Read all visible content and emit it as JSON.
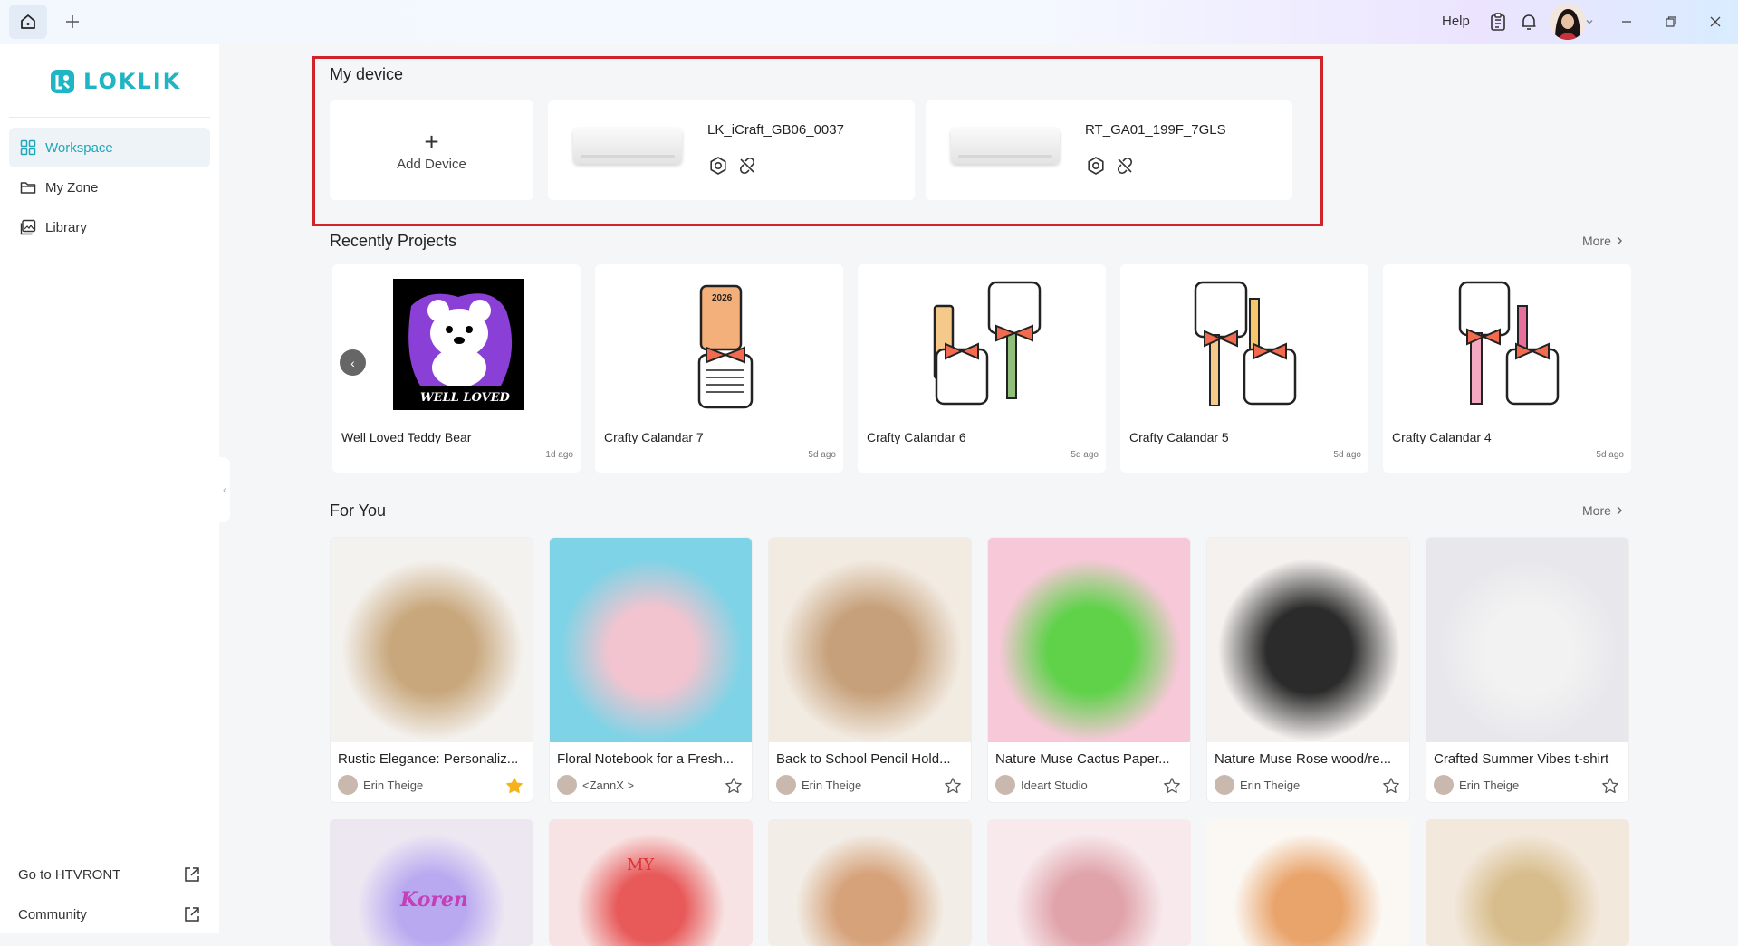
{
  "titlebar": {
    "help_label": "Help",
    "icons": [
      "home-icon",
      "plus-icon",
      "clipboard-icon",
      "bell-icon",
      "chevron-down-icon",
      "minimize-icon",
      "restore-icon",
      "close-icon"
    ]
  },
  "sidebar": {
    "logo_text": "LOKLIK",
    "items": [
      {
        "label": "Workspace",
        "icon": "grid-icon",
        "active": true
      },
      {
        "label": "My Zone",
        "icon": "folder-icon",
        "active": false
      },
      {
        "label": "Library",
        "icon": "image-icon",
        "active": false
      }
    ],
    "bottom": [
      {
        "label": "Go to HTVRONT",
        "icon": "external-link-icon"
      },
      {
        "label": "Community",
        "icon": "external-link-icon"
      }
    ]
  },
  "devices": {
    "title": "My device",
    "add_label": "Add Device",
    "list": [
      {
        "name": "LK_iCraft_GB06_0037"
      },
      {
        "name": "RT_GA01_199F_7GLS"
      }
    ]
  },
  "recent": {
    "title": "Recently Projects",
    "more_label": "More",
    "projects": [
      {
        "name": "Well Loved Teddy Bear",
        "time": "1d ago"
      },
      {
        "name": "Crafty Calandar 7",
        "time": "5d ago"
      },
      {
        "name": "Crafty Calandar 6",
        "time": "5d ago"
      },
      {
        "name": "Crafty Calandar 5",
        "time": "5d ago"
      },
      {
        "name": "Crafty Calandar 4",
        "time": "5d ago"
      }
    ],
    "thumb_text_bear": "WELL LOVED",
    "thumb_text_year": "2026"
  },
  "foryou": {
    "title": "For You",
    "more_label": "More",
    "items": [
      {
        "title": "Rustic Elegance: Personaliz...",
        "author": "Erin Theige",
        "starred": true,
        "colors": [
          "#f4f2ef",
          "#c8a77c"
        ]
      },
      {
        "title": "Floral Notebook for a Fresh...",
        "author": "<ZannX >",
        "starred": false,
        "colors": [
          "#7fd3e6",
          "#f2c4cf"
        ]
      },
      {
        "title": "Back to School Pencil Hold...",
        "author": "Erin Theige",
        "starred": false,
        "colors": [
          "#f2ebe2",
          "#c6a07a"
        ]
      },
      {
        "title": "Nature Muse Cactus Paper...",
        "author": "Ideart Studio",
        "starred": false,
        "colors": [
          "#f7c8d8",
          "#5fd24a"
        ]
      },
      {
        "title": "Nature Muse Rose wood/re...",
        "author": "Erin Theige",
        "starred": false,
        "colors": [
          "#f4f1ee",
          "#2b2b2b"
        ]
      },
      {
        "title": "Crafted Summer Vibes t-shirt",
        "author": "Erin Theige",
        "starred": false,
        "colors": [
          "#e8e8ec",
          "#f2f2f2"
        ]
      }
    ],
    "row2_colors": [
      [
        "#ede7f2",
        "#b9a9f0"
      ],
      [
        "#f7e3e3",
        "#e85a5a"
      ],
      [
        "#f2ede6",
        "#d6a27a"
      ],
      [
        "#f7e9ec",
        "#e0a3aa"
      ],
      [
        "#fbf7f2",
        "#e9a46b"
      ],
      [
        "#f2e8dc",
        "#d8bd8c"
      ]
    ],
    "row2_text": {
      "name_on_sign": "Koren",
      "card_text": "MY"
    }
  }
}
